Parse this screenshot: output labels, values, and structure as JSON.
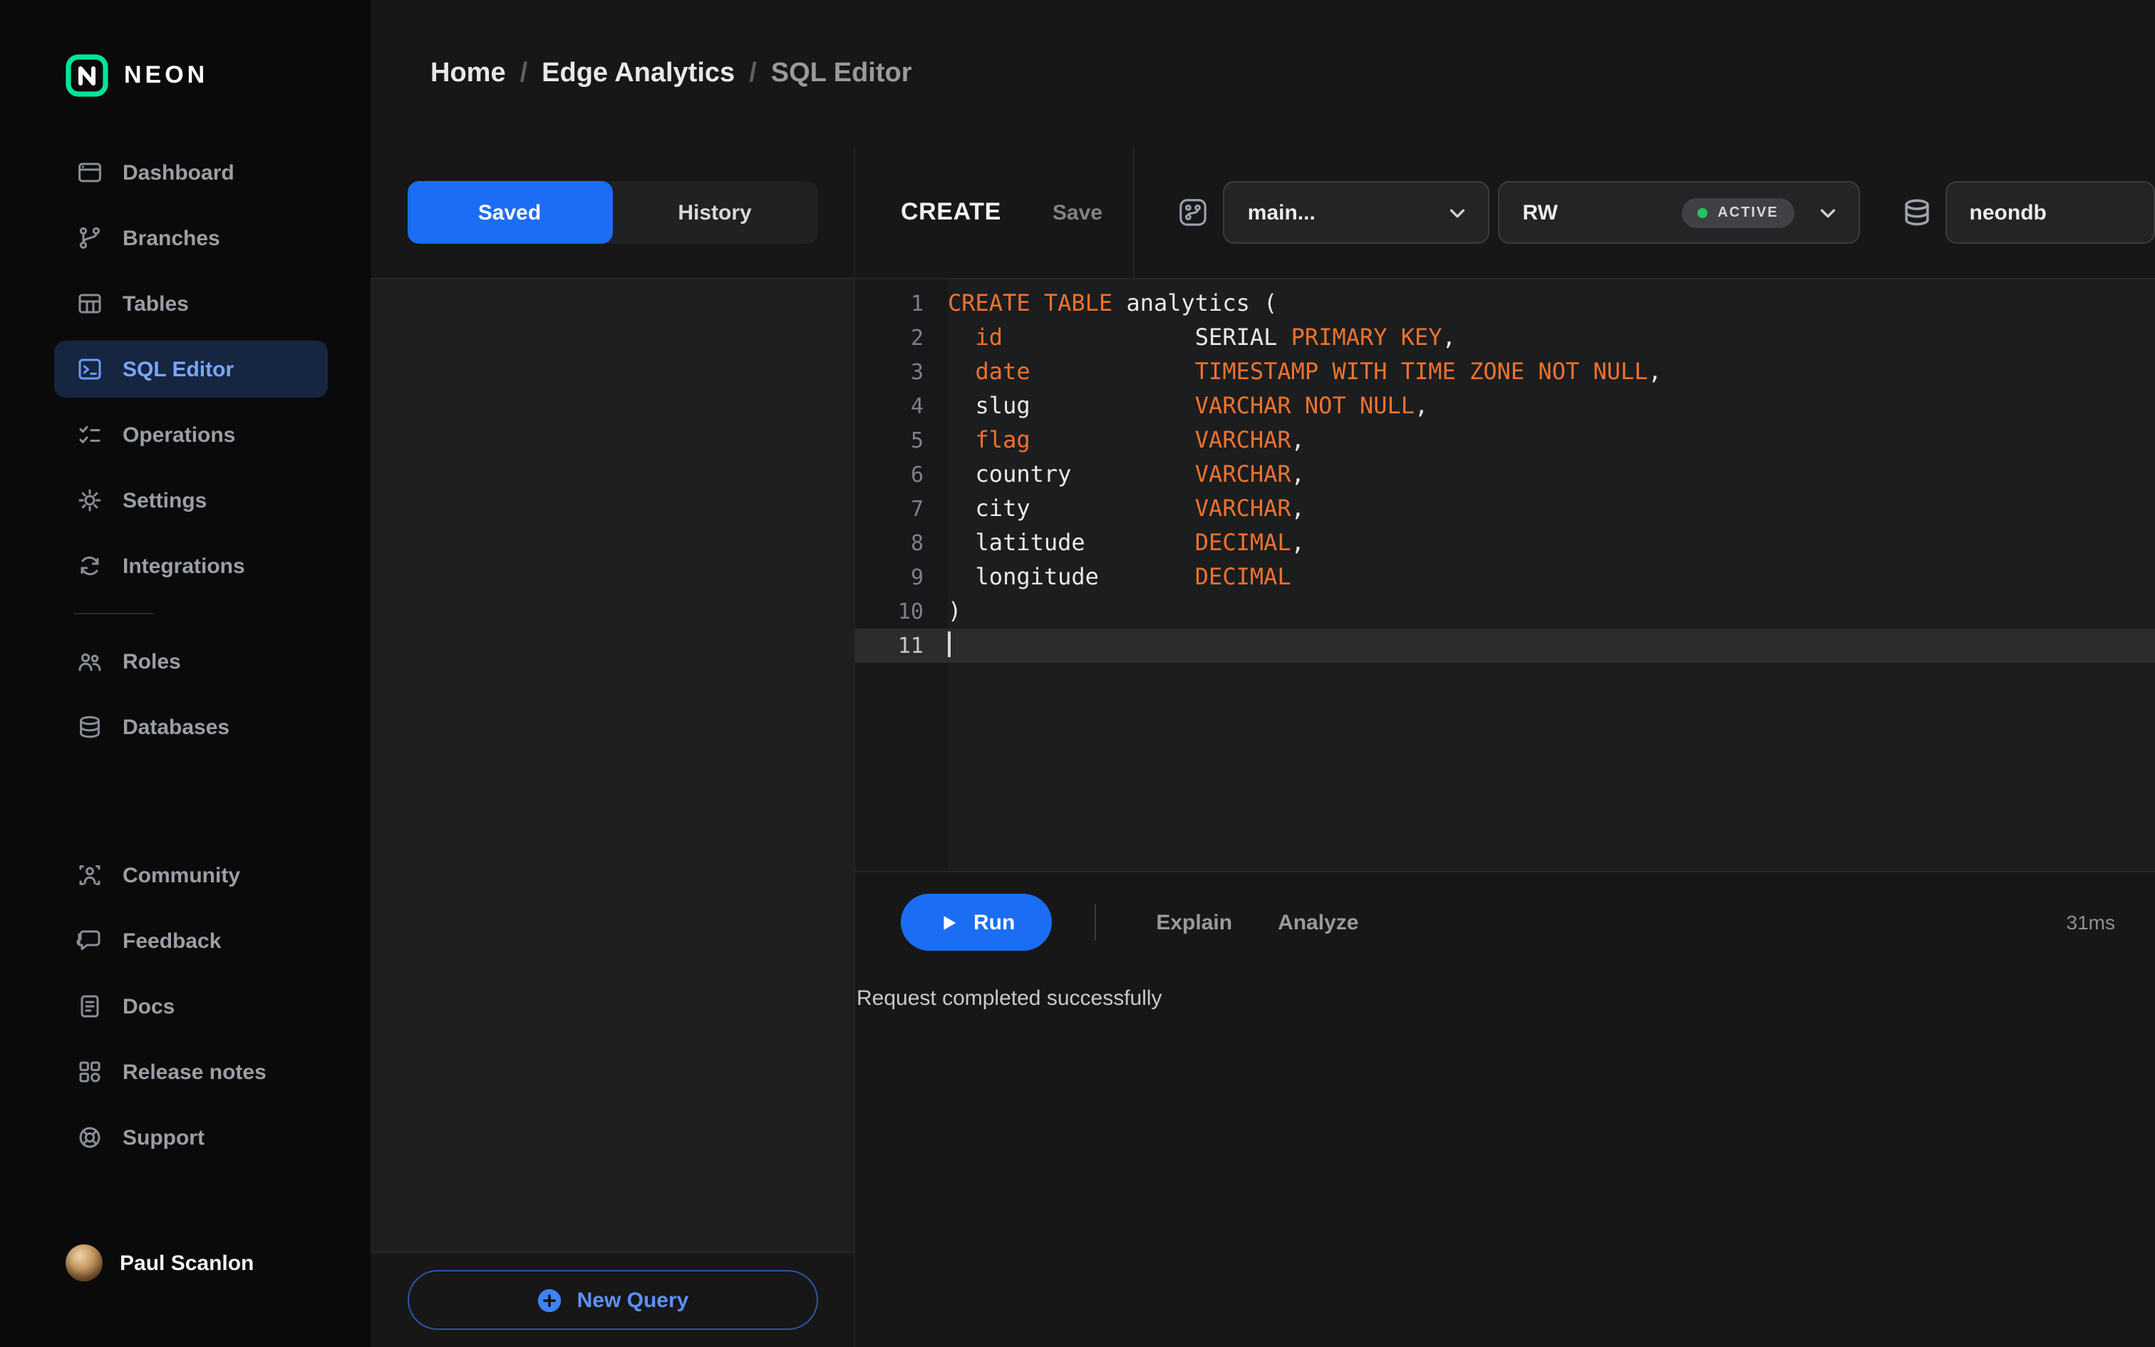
{
  "brand": {
    "name": "NEON"
  },
  "colors": {
    "accent": "#1b6ef3",
    "keyword": "#ee732e",
    "plain": "#e9e9e9",
    "green": "#22c55e",
    "logo_green": "#00e599"
  },
  "sidebar": {
    "groups": [
      {
        "items": [
          {
            "label": "Dashboard",
            "icon": "dashboard-icon"
          },
          {
            "label": "Branches",
            "icon": "branches-icon"
          },
          {
            "label": "Tables",
            "icon": "tables-icon"
          },
          {
            "label": "SQL Editor",
            "icon": "sql-editor-icon",
            "active": true
          },
          {
            "label": "Operations",
            "icon": "operations-icon"
          },
          {
            "label": "Settings",
            "icon": "settings-icon"
          },
          {
            "label": "Integrations",
            "icon": "integrations-icon"
          }
        ]
      },
      {
        "items": [
          {
            "label": "Roles",
            "icon": "roles-icon"
          },
          {
            "label": "Databases",
            "icon": "databases-icon"
          }
        ]
      },
      {
        "items": [
          {
            "label": "Community",
            "icon": "community-icon"
          },
          {
            "label": "Feedback",
            "icon": "feedback-icon"
          },
          {
            "label": "Docs",
            "icon": "docs-icon"
          },
          {
            "label": "Release notes",
            "icon": "release-notes-icon"
          },
          {
            "label": "Support",
            "icon": "support-icon"
          }
        ]
      }
    ],
    "user": {
      "name": "Paul Scanlon"
    }
  },
  "breadcrumb": {
    "items": [
      "Home",
      "Edge Analytics",
      "SQL Editor"
    ],
    "separator": "/"
  },
  "queries": {
    "tabs": [
      {
        "label": "Saved",
        "active": true
      },
      {
        "label": "History",
        "active": false
      }
    ],
    "new_query_label": "New Query"
  },
  "editor": {
    "title": "CREATE",
    "save_label": "Save",
    "branch_selector": "main...",
    "compute": "RW",
    "compute_status": "ACTIVE",
    "database": "neondb",
    "run_label": "Run",
    "explain_label": "Explain",
    "analyze_label": "Analyze",
    "duration": "31ms",
    "status_message": "Request completed successfully",
    "code": {
      "lines": [
        {
          "n": "1",
          "tokens": [
            [
              "kw",
              "CREATE TABLE"
            ],
            [
              "pl",
              " analytics ("
            ]
          ]
        },
        {
          "n": "2",
          "tokens": [
            [
              "pl",
              "  "
            ],
            [
              "kw",
              "id"
            ],
            [
              "pl",
              "              SERIAL "
            ],
            [
              "kw",
              "PRIMARY KEY"
            ],
            [
              "pl",
              ","
            ]
          ]
        },
        {
          "n": "3",
          "tokens": [
            [
              "pl",
              "  "
            ],
            [
              "kw",
              "date"
            ],
            [
              "pl",
              "            "
            ],
            [
              "kw",
              "TIMESTAMP WITH TIME ZONE NOT NULL"
            ],
            [
              "pl",
              ","
            ]
          ]
        },
        {
          "n": "4",
          "tokens": [
            [
              "pl",
              "  slug            "
            ],
            [
              "kw",
              "VARCHAR NOT NULL"
            ],
            [
              "pl",
              ","
            ]
          ]
        },
        {
          "n": "5",
          "tokens": [
            [
              "pl",
              "  "
            ],
            [
              "kw",
              "flag"
            ],
            [
              "pl",
              "            "
            ],
            [
              "kw",
              "VARCHAR"
            ],
            [
              "pl",
              ","
            ]
          ]
        },
        {
          "n": "6",
          "tokens": [
            [
              "pl",
              "  country         "
            ],
            [
              "kw",
              "VARCHAR"
            ],
            [
              "pl",
              ","
            ]
          ]
        },
        {
          "n": "7",
          "tokens": [
            [
              "pl",
              "  city            "
            ],
            [
              "kw",
              "VARCHAR"
            ],
            [
              "pl",
              ","
            ]
          ]
        },
        {
          "n": "8",
          "tokens": [
            [
              "pl",
              "  latitude        "
            ],
            [
              "kw",
              "DECIMAL"
            ],
            [
              "pl",
              ","
            ]
          ]
        },
        {
          "n": "9",
          "tokens": [
            [
              "pl",
              "  longitude       "
            ],
            [
              "kw",
              "DECIMAL"
            ]
          ]
        },
        {
          "n": "10",
          "tokens": [
            [
              "pl",
              ")"
            ]
          ]
        },
        {
          "n": "11",
          "tokens": [],
          "caret": true
        }
      ]
    }
  }
}
